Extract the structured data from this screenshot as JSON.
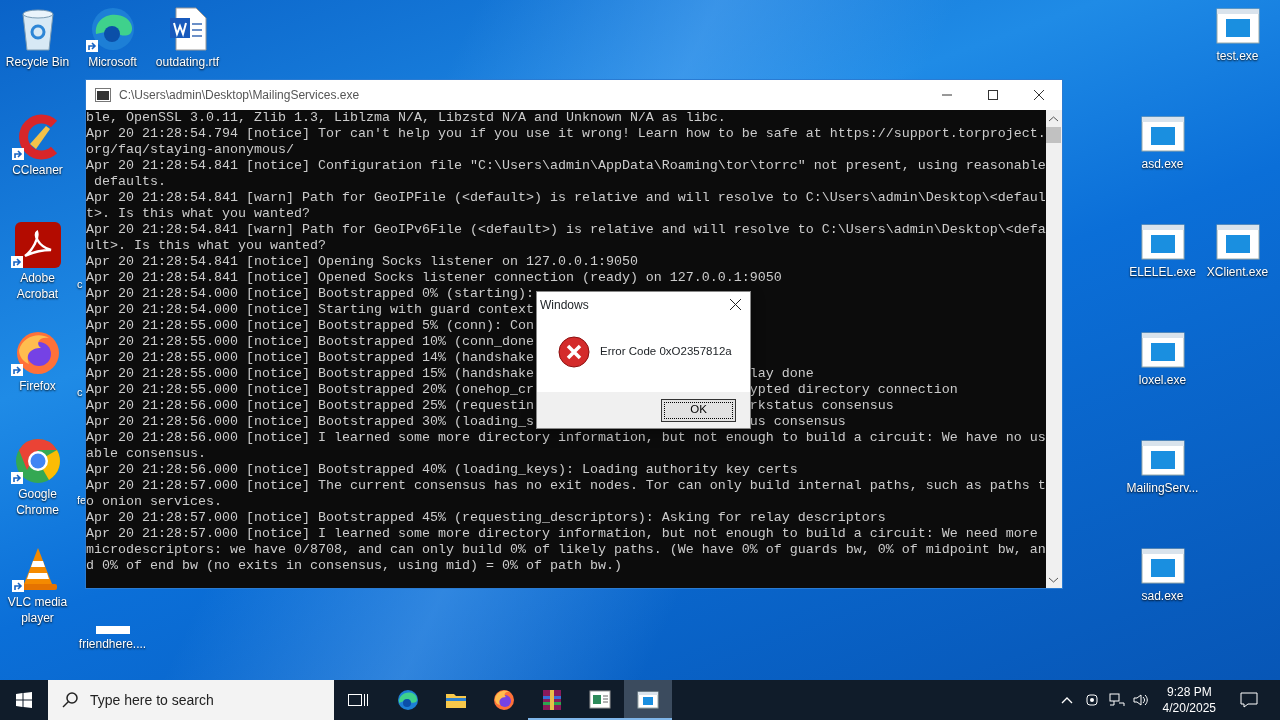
{
  "desktop_icons": [
    {
      "label": "Recycle Bin",
      "kind": "recycle",
      "shortcut": false
    },
    {
      "label": "CCleaner",
      "kind": "ccleaner",
      "shortcut": true
    },
    {
      "label": "Adobe Acrobat",
      "kind": "acrobat",
      "shortcut": true
    },
    {
      "label": "Firefox",
      "kind": "firefox",
      "shortcut": true
    },
    {
      "label": "Google Chrome",
      "kind": "chrome",
      "shortcut": true
    },
    {
      "label": "VLC media player",
      "kind": "vlc",
      "shortcut": true
    },
    {
      "label": "Microsoft",
      "kind": "edge",
      "shortcut": true
    },
    {
      "label": "c",
      "kind": "hidden"
    },
    {
      "label": "c",
      "kind": "hidden"
    },
    {
      "label": "fe",
      "kind": "hidden"
    },
    {
      "label": "friendhere....",
      "kind": "file",
      "shortcut": false
    },
    {
      "label": "outdating.rtf",
      "kind": "word",
      "shortcut": false
    },
    {
      "label": "asd.exe",
      "kind": "exe",
      "shortcut": false
    },
    {
      "label": "ELELEL.exe",
      "kind": "exe",
      "shortcut": false
    },
    {
      "label": "loxel.exe",
      "kind": "exe",
      "shortcut": false
    },
    {
      "label": "MailingServ...",
      "kind": "exe",
      "shortcut": false
    },
    {
      "label": "sad.exe",
      "kind": "exe",
      "shortcut": false
    },
    {
      "label": "test.exe",
      "kind": "exe",
      "shortcut": false
    },
    {
      "label": "XClient.exe",
      "kind": "exe",
      "shortcut": false
    }
  ],
  "console_window": {
    "title": "C:\\Users\\admin\\Desktop\\MailingServices.exe",
    "lines": [
      {
        "text": "ble, OpenSSL 3.0.11, Zlib 1.3, Liblzma N/A, Libzstd N/A and Unknown N/A as libc."
      },
      {
        "text": "Apr 20 21:28:54.794 [notice] Tor can't help you if you use it wrong! Learn how to be safe at https://support.torproject."
      },
      {
        "text": "org/faq/staying-anonymous/"
      },
      {
        "text": "Apr 20 21:28:54.841 [notice] Configuration file \"C:\\Users\\admin\\AppData\\Roaming\\tor\\torrc\" not present, using reasonable"
      },
      {
        "text": " defaults."
      },
      {
        "text": "Apr 20 21:28:54.841 [warn] Path for GeoIPFile (<default>) is relative and will resolve to C:\\Users\\admin\\Desktop\\<defaul"
      },
      {
        "text": "t>. Is this what you wanted?"
      },
      {
        "text": "Apr 20 21:28:54.841 [warn] Path for GeoIPv6File (<default>) is relative and will resolve to C:\\Users\\admin\\Desktop\\<defa"
      },
      {
        "text": "ult>. Is this what you wanted?"
      },
      {
        "text": "Apr 20 21:28:54.841 [notice] Opening Socks listener on 127.0.0.1:9050"
      },
      {
        "text": "Apr 20 21:28:54.841 [notice] Opened Socks listener connection (ready) on 127.0.0.1:9050"
      },
      {
        "text": "Apr 20 21:28:54.000 [notice] Bootstrapped 0% (starting):"
      },
      {
        "text": "Apr 20 21:28:54.000 [notice] Starting with guard context"
      },
      {
        "text": "Apr 20 21:28:55.000 [notice] Bootstrapped 5% (conn): Con"
      },
      {
        "text": "Apr 20 21:28:55.000 [notice] Bootstrapped 10% (conn_done"
      },
      {
        "text": "Apr 20 21:28:55.000 [notice] Bootstrapped 14% (handshake"
      },
      {
        "text": "Apr 20 21:28:55.000 [notice] Bootstrapped 15% (handshake",
        "tail": "lay done"
      },
      {
        "text": "Apr 20 21:28:55.000 [notice] Bootstrapped 20% (onehop_cr",
        "tail": "ypted directory connection"
      },
      {
        "text": "Apr 20 21:28:56.000 [notice] Bootstrapped 25% (requestin",
        "tail": "rkstatus consensus"
      },
      {
        "text": "Apr 20 21:28:56.000 [notice] Bootstrapped 30% (loading_s",
        "tail": "us consensus"
      },
      {
        "text": "Apr 20 21:28:56.000 [notice] I learned some more directory information, but not enough to build a circuit: We have no us"
      },
      {
        "text": "able consensus."
      },
      {
        "text": "Apr 20 21:28:56.000 [notice] Bootstrapped 40% (loading_keys): Loading authority key certs"
      },
      {
        "text": "Apr 20 21:28:57.000 [notice] The current consensus has no exit nodes. Tor can only build internal paths, such as paths t"
      },
      {
        "text": "o onion services."
      },
      {
        "text": "Apr 20 21:28:57.000 [notice] Bootstrapped 45% (requesting_descriptors): Asking for relay descriptors"
      },
      {
        "text": "Apr 20 21:28:57.000 [notice] I learned some more directory information, but not enough to build a circuit: We need more"
      },
      {
        "text": "microdescriptors: we have 0/8708, and can only build 0% of likely paths. (We have 0% of guards bw, 0% of midpoint bw, an"
      },
      {
        "text": "d 0% of end bw (no exits in consensus, using mid) = 0% of path bw.)"
      }
    ]
  },
  "dialog": {
    "title": "Windows",
    "message": "Error Code 0xO2357812a",
    "button": "OK"
  },
  "taskbar": {
    "search": {
      "placeholder": "Type here to search"
    },
    "apps": [
      {
        "kind": "taskview",
        "running": false,
        "selected": false
      },
      {
        "kind": "edge",
        "running": false,
        "selected": false
      },
      {
        "kind": "explorer",
        "running": false,
        "selected": false
      },
      {
        "kind": "firefox",
        "running": false,
        "selected": false
      },
      {
        "kind": "winrar",
        "running": true,
        "selected": false
      },
      {
        "kind": "app",
        "running": true,
        "selected": false
      },
      {
        "kind": "console",
        "running": true,
        "selected": true
      }
    ],
    "time": "9:28 PM",
    "date": "4/20/2025"
  }
}
